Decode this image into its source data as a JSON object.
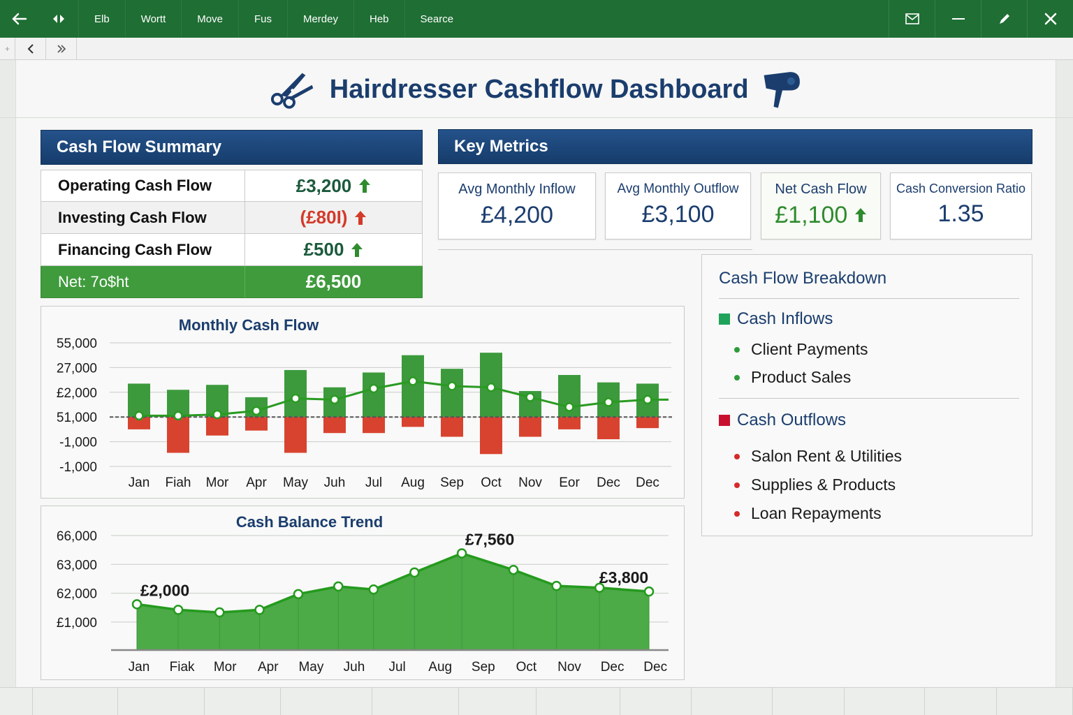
{
  "topbar": {
    "menu": [
      "Elb",
      "Wortt",
      "Move",
      "Fus",
      "Merdey",
      "Heb",
      "Searce"
    ]
  },
  "title": "Hairdresser Cashflow Dashboard",
  "summary": {
    "header": "Cash Flow Summary",
    "rows": [
      {
        "label": "Operating Cash Flow",
        "value": "£3,200"
      },
      {
        "label": "Investing Cash Flow",
        "value": "(£80I)"
      },
      {
        "label": "Financing Cash Flow",
        "value": "£500"
      }
    ],
    "net": {
      "label": "Net: 7o$ht",
      "value": "£6,500"
    }
  },
  "metrics": {
    "header": "Key Metrics",
    "cards": [
      {
        "label": "Avg Monthly Inflow",
        "value": "£4,200"
      },
      {
        "label": "Avg Monthly Outflow",
        "value": "£3,100"
      },
      {
        "label": "Net Cash Flow",
        "value": "£1,100"
      },
      {
        "label": "Cash Conversion Ratio",
        "value": "1.35"
      }
    ]
  },
  "breakdown": {
    "title": "Cash Flow Breakdown",
    "inflows_label": "Cash Inflows",
    "inflows": [
      "Client Payments",
      "Product Sales"
    ],
    "outflows_label": "Cash Outflows",
    "outflows": [
      "Salon Rent & Utilities",
      "Supplies & Products",
      "Loan Repayments"
    ]
  },
  "colors": {
    "accent_green": "#3f9b3c",
    "header_blue": "#1b3d6e",
    "negative_red": "#d43a2a",
    "positive_arrow": "#2e8b2e",
    "inflow_square": "#1fa35a",
    "outflow_square": "#c8102e"
  },
  "chart_data": [
    {
      "type": "bar",
      "title": "Monthly Cash Flow",
      "y_tick_labels": [
        "55,000",
        "27,000",
        "£2,000",
        "51,000",
        "-1,000",
        "-1,000"
      ],
      "categories": [
        "Jan",
        "Fiah",
        "Mor",
        "Apr",
        "May",
        "Juh",
        "Jul",
        "Aug",
        "Sep",
        "Oct",
        "Nov",
        "Eor",
        "Dec",
        "Dec"
      ],
      "series": [
        {
          "values": [
            1.35,
            1.1,
            1.3,
            0.8,
            1.9,
            1.2,
            1.8,
            2.5,
            1.95,
            2.6,
            1.05,
            1.7,
            1.4,
            1.35
          ]
        },
        {
          "values": [
            -0.5,
            -1.45,
            -0.75,
            -0.55,
            -1.45,
            -0.65,
            -0.65,
            -0.4,
            -0.8,
            -1.5,
            -0.8,
            -0.5,
            -0.9,
            -0.45
          ]
        },
        {
          "values": [
            0.05,
            0.05,
            0.1,
            0.25,
            0.75,
            0.7,
            1.15,
            1.45,
            1.25,
            1.2,
            0.8,
            0.4,
            0.6,
            0.7
          ]
        }
      ],
      "ylim": [
        -2.0,
        3.0
      ]
    },
    {
      "type": "area",
      "title": "Cash Balance Trend",
      "y_tick_labels": [
        "66,000",
        "63,000",
        "62,000",
        "£1,000"
      ],
      "categories": [
        "Jan",
        "Fiak",
        "Mor",
        "Apr",
        "May",
        "Juh",
        "Jul",
        "Aug",
        "Sep",
        "Oct",
        "Nov",
        "Dec",
        "Dec"
      ],
      "points": [
        {
          "x": 0,
          "y": 1.8
        },
        {
          "x": 0.96,
          "y": 1.58
        },
        {
          "x": 1.92,
          "y": 1.48
        },
        {
          "x": 2.85,
          "y": 1.58
        },
        {
          "x": 3.75,
          "y": 2.2
        },
        {
          "x": 4.68,
          "y": 2.5
        },
        {
          "x": 5.5,
          "y": 2.38
        },
        {
          "x": 6.45,
          "y": 3.05
        },
        {
          "x": 7.55,
          "y": 3.8
        },
        {
          "x": 8.75,
          "y": 3.15
        },
        {
          "x": 9.75,
          "y": 2.52
        },
        {
          "x": 10.75,
          "y": 2.45
        },
        {
          "x": 11.9,
          "y": 2.3
        }
      ],
      "x_positions": [
        0,
        1,
        2,
        3,
        4,
        5,
        6,
        7,
        8,
        9,
        10,
        11,
        12
      ],
      "annotations": [
        {
          "text": "£2,000",
          "x": 0,
          "y": 1.8
        },
        {
          "text": "£7,560",
          "x": 7.55,
          "y": 3.8
        },
        {
          "text": "£3,800",
          "x": 11.9,
          "y": 2.3
        }
      ],
      "ylim": [
        0,
        4.5
      ]
    }
  ]
}
